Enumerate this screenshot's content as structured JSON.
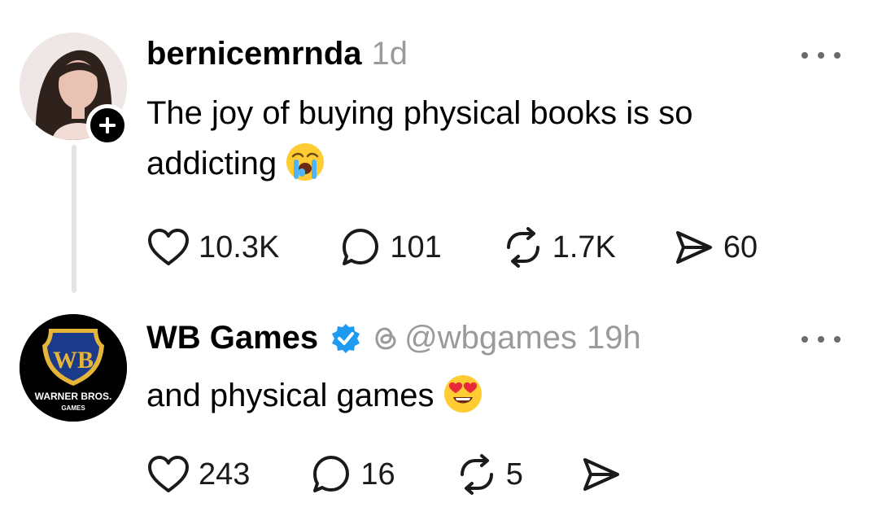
{
  "posts": [
    {
      "username": "bernicemrnda",
      "time": "1d",
      "text": "The joy of buying physical books is so addicting",
      "text_emoji": "loudly-crying-face",
      "follow_icon": "plus-icon",
      "actions": {
        "likes": "10.3K",
        "replies": "101",
        "reposts": "1.7K",
        "shares": "60"
      }
    },
    {
      "username": "WB Games",
      "verified": true,
      "handle": "@wbgames",
      "time": "19h",
      "text": "and physical games",
      "text_emoji": "smiling-face-with-heart-eyes",
      "avatar_logo": {
        "letters": "WB",
        "brand": "WARNER BROS.",
        "sub": "GAMES"
      },
      "actions": {
        "likes": "243",
        "replies": "16",
        "reposts": "5"
      }
    }
  ],
  "colors": {
    "verified_blue": "#1d9bf0",
    "muted_gray": "#9a9a9a",
    "wb_gold": "#e5b53a",
    "wb_blue": "#1b3a8a"
  }
}
